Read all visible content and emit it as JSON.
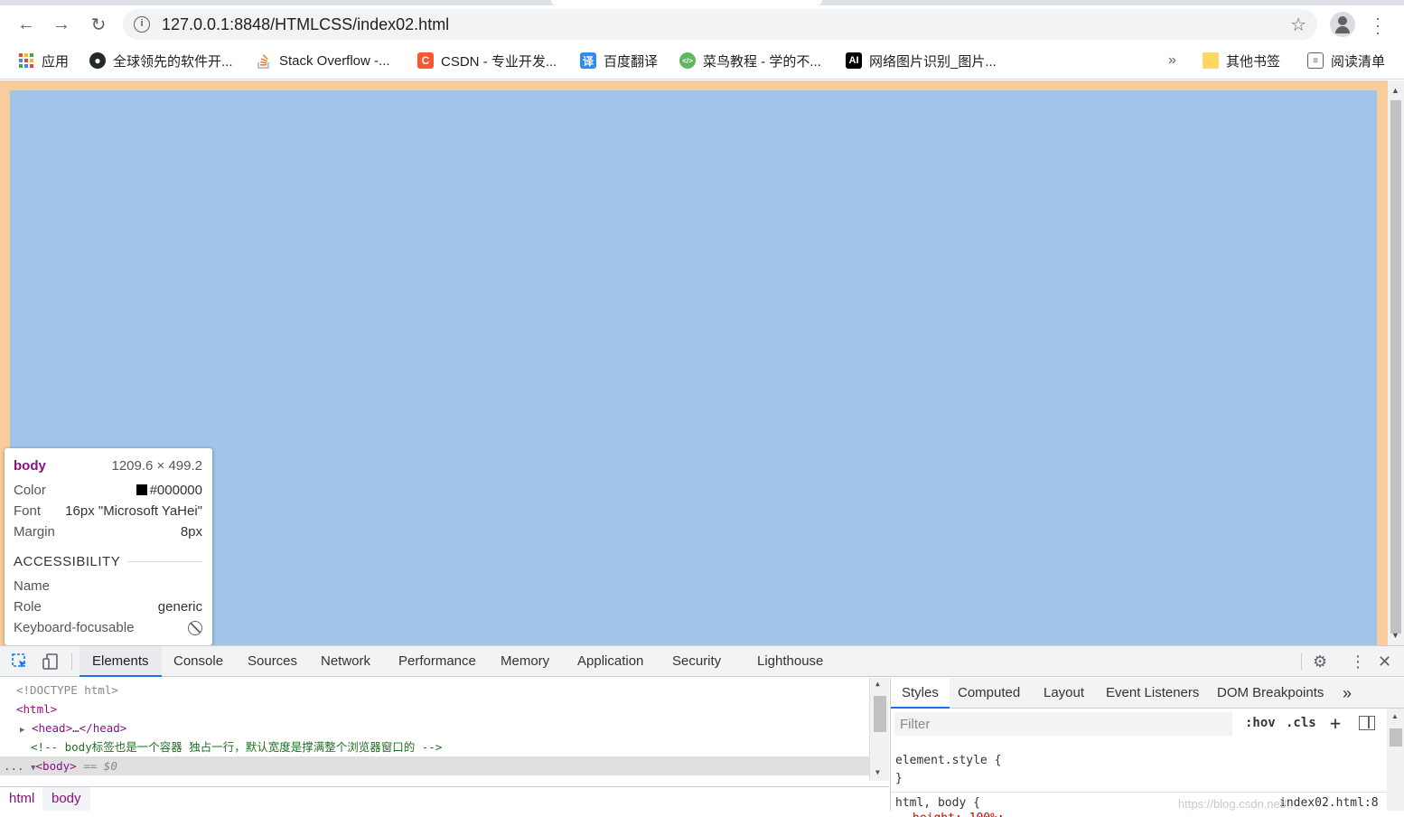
{
  "browser": {
    "url": "127.0.0.1:8848/HTMLCSS/index02.html"
  },
  "bookmarks": [
    {
      "label": "应用",
      "icon": "apps-grid-icon"
    },
    {
      "label": "全球领先的软件开...",
      "icon": "github-icon"
    },
    {
      "label": "Stack Overflow -...",
      "icon": "stackoverflow-icon"
    },
    {
      "label": "CSDN - 专业开发...",
      "icon": "csdn-icon"
    },
    {
      "label": "百度翻译",
      "icon": "baidu-translate-icon",
      "icon_text": "译"
    },
    {
      "label": "菜鸟教程 - 学的不...",
      "icon": "runoob-icon"
    },
    {
      "label": "网络图片识别_图片...",
      "icon": "ai-icon",
      "icon_text": "AI"
    }
  ],
  "bookmarks_right": {
    "overflow": "»",
    "other": "其他书签",
    "reading_list": "阅读清单"
  },
  "page": {
    "html_bg": "#f9cc9d",
    "body_bg": "#a0c5e8"
  },
  "tooltip": {
    "tag": "body",
    "size": "1209.6 × 499.2",
    "color_label": "Color",
    "color_value": "#000000",
    "font_label": "Font",
    "font_value": "16px \"Microsoft YaHei\"",
    "margin_label": "Margin",
    "margin_value": "8px",
    "section": "ACCESSIBILITY",
    "name_label": "Name",
    "role_label": "Role",
    "role_value": "generic",
    "focus_label": "Keyboard-focusable"
  },
  "devtools": {
    "tabs": [
      "Elements",
      "Console",
      "Sources",
      "Network",
      "Performance",
      "Memory",
      "Application",
      "Security",
      "Lighthouse"
    ],
    "active_tab": "Elements",
    "code": {
      "doctype": "<!DOCTYPE html>",
      "html_open": "<html>",
      "head_open": "<head>",
      "head_ellipsis": "…",
      "head_close": "</head>",
      "comment": "<!-- body标签也是一个容器 独占一行，默认宽度是撑满整个浏览器窗口的 -->",
      "body_open": "<body>",
      "body_eq": " == $0",
      "ellipsis": "..."
    },
    "breadcrumbs": [
      "html",
      "body"
    ],
    "styles_tabs": [
      "Styles",
      "Computed",
      "Layout",
      "Event Listeners",
      "DOM Breakpoints"
    ],
    "styles_more": "»",
    "filter_placeholder": "Filter",
    "hov": ":hov",
    "cls": ".cls",
    "plus": "+",
    "element_style": "element.style {",
    "close_brace": "}",
    "rule_selector": "html, body {",
    "rule_source": "index02.html:8",
    "rule_partial": "height: 100%;",
    "watermark": "https://blog.csdn.net/..."
  }
}
